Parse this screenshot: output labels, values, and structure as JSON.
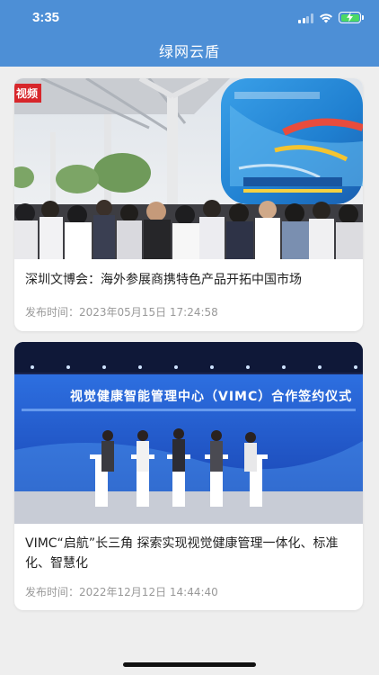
{
  "status_bar": {
    "time": "3:35"
  },
  "header": {
    "title": "绿网云盾"
  },
  "articles": [
    {
      "image_icon": "expo-crowd-photo",
      "badge": "视频",
      "headline": "深圳文博会：海外参展商携特色产品开拓中国市场",
      "date": "发布时间：2023年05月15日 17:24:58"
    },
    {
      "image_icon": "signing-ceremony-photo",
      "banner": "视觉健康智能管理中心（VIMC）合作签约仪式",
      "headline": "VIMC“启航”长三角 探索实现视觉健康管理一体化、标准化、智慧化",
      "date": "发布时间：2022年12月12日 14:44:40"
    }
  ],
  "colors": {
    "header": "#4d8fd6",
    "background": "#eeeeee",
    "card": "#ffffff",
    "headline": "#222222",
    "date": "#999999"
  }
}
